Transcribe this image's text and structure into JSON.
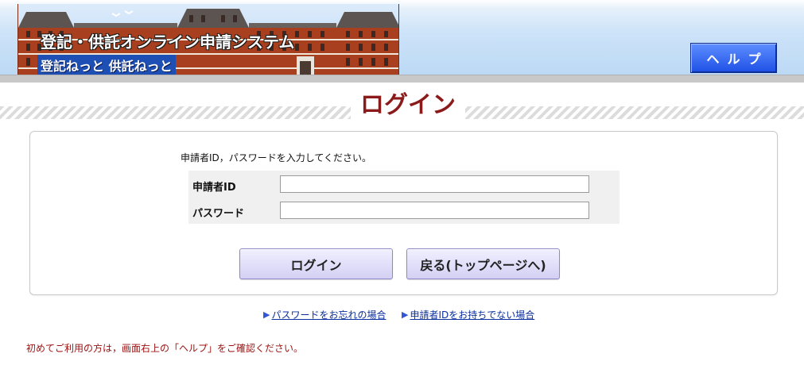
{
  "header": {
    "banner_title": "登記・供託オンライン申請システム",
    "banner_subtitle": "登記ねっと 供託ねっと",
    "help_label": "ヘルプ"
  },
  "page": {
    "title": "ログイン",
    "instruction": "申請者ID，パスワードを入力してください。"
  },
  "form": {
    "applicant_id_label": "申請者ID",
    "applicant_id_value": "",
    "password_label": "パスワード",
    "password_value": ""
  },
  "buttons": {
    "login": "ログイン",
    "back": "戻る(トップページへ)"
  },
  "links": {
    "forgot_password": "パスワードをお忘れの場合",
    "no_applicant_id": "申請者IDをお持ちでない場合"
  },
  "notice": "初めてご利用の方は，画面右上の「ヘルプ」をご確認ください。",
  "colors": {
    "title": "#8b1a1a",
    "help_button": "#1e50e6",
    "link": "#0b2f9e",
    "notice": "#9b1111"
  }
}
